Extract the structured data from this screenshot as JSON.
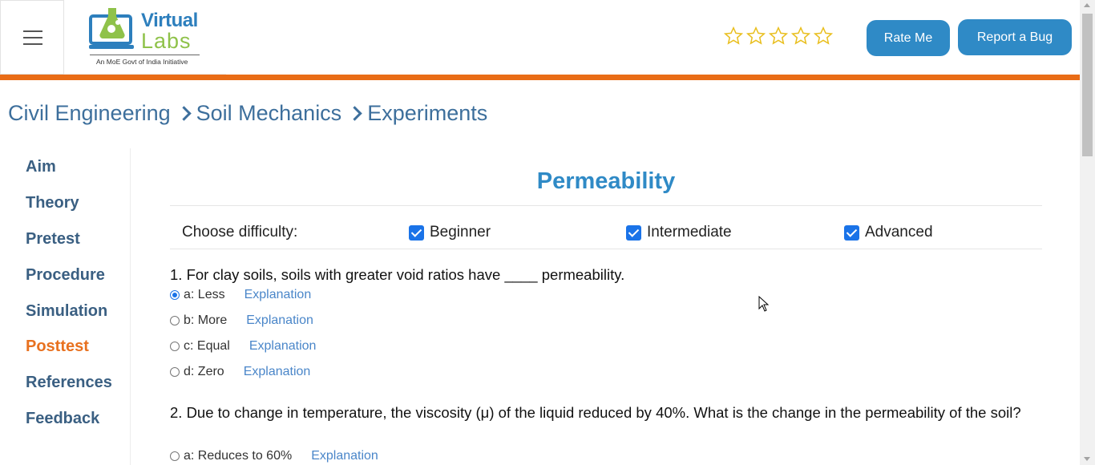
{
  "header": {
    "logo": {
      "word1": "Virtual",
      "word2": "Labs",
      "tagline": "An MoE Govt of India Initiative"
    },
    "rating_stars": 0,
    "rate_button": "Rate Me",
    "bug_button": "Report a Bug",
    "accent_color": "#e96c16",
    "button_color": "#2f8ac6"
  },
  "breadcrumb": [
    "Civil Engineering",
    "Soil Mechanics",
    "Experiments"
  ],
  "sidebar": {
    "items": [
      {
        "label": "Aim"
      },
      {
        "label": "Theory"
      },
      {
        "label": "Pretest"
      },
      {
        "label": "Procedure"
      },
      {
        "label": "Simulation"
      },
      {
        "label": "Posttest"
      },
      {
        "label": "References"
      },
      {
        "label": "Feedback"
      }
    ],
    "active": "Posttest"
  },
  "main": {
    "title": "Permeability",
    "difficulty_label": "Choose difficulty:",
    "difficulties": [
      {
        "label": "Beginner",
        "checked": true
      },
      {
        "label": "Intermediate",
        "checked": true
      },
      {
        "label": "Advanced",
        "checked": true
      }
    ],
    "questions": [
      {
        "text": "1. For clay soils, soils with greater void ratios have ____ permeability.",
        "options": [
          {
            "label": "a: Less",
            "explanation": "Explanation",
            "selected": true
          },
          {
            "label": "b: More",
            "explanation": "Explanation",
            "selected": false
          },
          {
            "label": "c: Equal",
            "explanation": "Explanation",
            "selected": false
          },
          {
            "label": "d: Zero",
            "explanation": "Explanation",
            "selected": false
          }
        ]
      },
      {
        "text": "2. Due to change in temperature, the viscosity (μ) of the liquid reduced by 40%. What is the change in the permeability of the soil?",
        "options": [
          {
            "label": "a: Reduces to 60%",
            "explanation": "Explanation",
            "selected": false
          }
        ]
      }
    ]
  }
}
